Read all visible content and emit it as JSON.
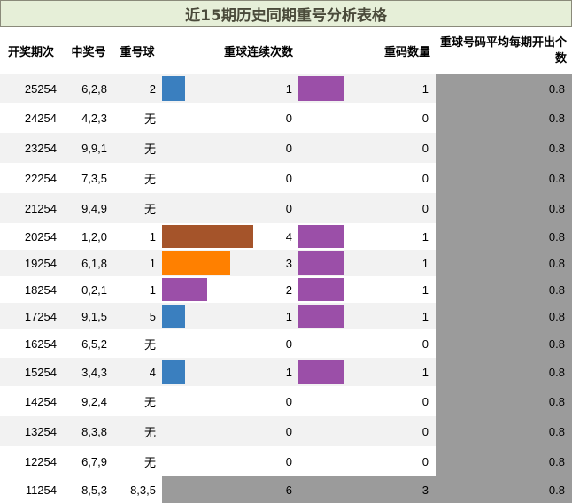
{
  "title": "近15期历史同期重号分析表格",
  "headers": {
    "period": "开奖期次",
    "winning": "中奖号",
    "repeat_ball": "重号球",
    "consecutive": "重球连续次数",
    "repeat_count": "重码数量",
    "avg": "重球号码平均每期开出个数"
  },
  "colors": {
    "title_bg": "#e6efd8",
    "stripe": "#f2f2f2",
    "avg_bg": "#9b9b9b",
    "blue": "#3a7fbf",
    "brown": "#a5542a",
    "orange": "#ff8000",
    "purple": "#9b4fa8"
  },
  "scale": {
    "consecutive_max": 6,
    "count_max": 3
  },
  "rows": [
    {
      "period": "25254",
      "winning": "6,2,8",
      "repeat": "2",
      "consecutive": "1",
      "count": "1",
      "avg": "0.8",
      "cons_color": "blue"
    },
    {
      "period": "24254",
      "winning": "4,2,3",
      "repeat": "无",
      "consecutive": "0",
      "count": "0",
      "avg": "0.8",
      "cons_color": ""
    },
    {
      "period": "23254",
      "winning": "9,9,1",
      "repeat": "无",
      "consecutive": "0",
      "count": "0",
      "avg": "0.8",
      "cons_color": ""
    },
    {
      "period": "22254",
      "winning": "7,3,5",
      "repeat": "无",
      "consecutive": "0",
      "count": "0",
      "avg": "0.8",
      "cons_color": ""
    },
    {
      "period": "21254",
      "winning": "9,4,9",
      "repeat": "无",
      "consecutive": "0",
      "count": "0",
      "avg": "0.8",
      "cons_color": ""
    },
    {
      "period": "20254",
      "winning": "1,2,0",
      "repeat": "1",
      "consecutive": "4",
      "count": "1",
      "avg": "0.8",
      "cons_color": "brown"
    },
    {
      "period": "19254",
      "winning": "6,1,8",
      "repeat": "1",
      "consecutive": "3",
      "count": "1",
      "avg": "0.8",
      "cons_color": "orange"
    },
    {
      "period": "18254",
      "winning": "0,2,1",
      "repeat": "1",
      "consecutive": "2",
      "count": "1",
      "avg": "0.8",
      "cons_color": "purple"
    },
    {
      "period": "17254",
      "winning": "9,1,5",
      "repeat": "5",
      "consecutive": "1",
      "count": "1",
      "avg": "0.8",
      "cons_color": "blue"
    },
    {
      "period": "16254",
      "winning": "6,5,2",
      "repeat": "无",
      "consecutive": "0",
      "count": "0",
      "avg": "0.8",
      "cons_color": ""
    },
    {
      "period": "15254",
      "winning": "3,4,3",
      "repeat": "4",
      "consecutive": "1",
      "count": "1",
      "avg": "0.8",
      "cons_color": "blue"
    },
    {
      "period": "14254",
      "winning": "9,2,4",
      "repeat": "无",
      "consecutive": "0",
      "count": "0",
      "avg": "0.8",
      "cons_color": ""
    },
    {
      "period": "13254",
      "winning": "8,3,8",
      "repeat": "无",
      "consecutive": "0",
      "count": "0",
      "avg": "0.8",
      "cons_color": ""
    },
    {
      "period": "12254",
      "winning": "6,7,9",
      "repeat": "无",
      "consecutive": "0",
      "count": "0",
      "avg": "0.8",
      "cons_color": ""
    },
    {
      "period": "11254",
      "winning": "8,5,3",
      "repeat": "8,3,5",
      "consecutive": "6",
      "count": "3",
      "avg": "0.8",
      "cons_color": "",
      "summary": true
    }
  ]
}
